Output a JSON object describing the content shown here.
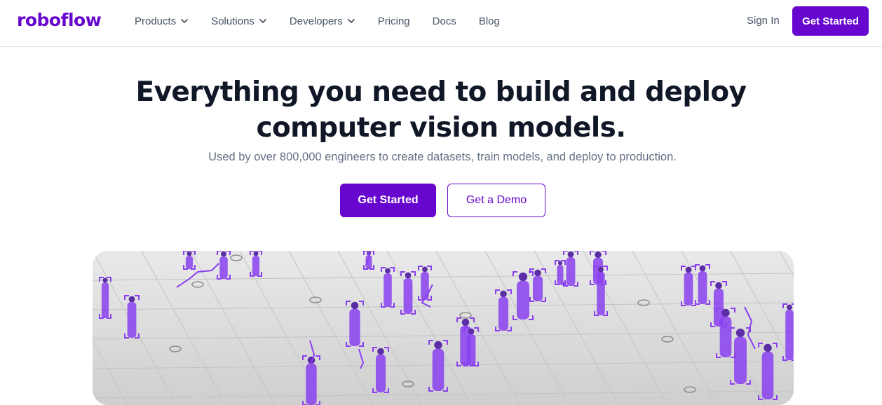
{
  "nav": {
    "logo": "roboflow",
    "links": [
      {
        "label": "Products",
        "dropdown": true
      },
      {
        "label": "Solutions",
        "dropdown": true
      },
      {
        "label": "Developers",
        "dropdown": true
      },
      {
        "label": "Pricing",
        "dropdown": false
      },
      {
        "label": "Docs",
        "dropdown": false
      },
      {
        "label": "Blog",
        "dropdown": false
      }
    ],
    "sign_in": "Sign In",
    "cta": "Get Started"
  },
  "hero": {
    "title_line1": "Everything you need to build and deploy",
    "title_line2": "computer vision models.",
    "subtitle": "Used by over 800,000 engineers to create datasets, train models, and deploy to production.",
    "primary_button": "Get Started",
    "secondary_button": "Get a Demo"
  },
  "colors": {
    "brand": "#6706ce",
    "detection": "#8a3ff0",
    "heading": "#101828",
    "muted": "#667085"
  }
}
